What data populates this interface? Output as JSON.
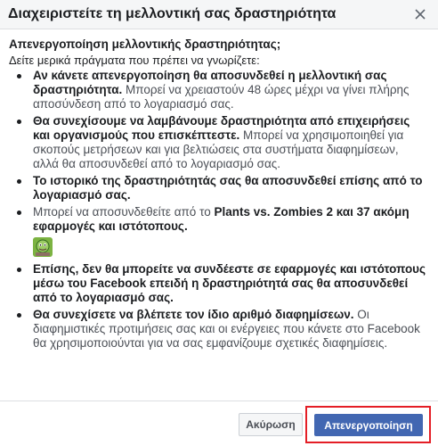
{
  "dialog": {
    "title": "Διαχειριστείτε τη μελλοντική σας δραστηριότητα",
    "close_icon": "close-icon"
  },
  "intro": {
    "question": "Απενεργοποίηση μελλοντικής δραστηριότητας;",
    "subtitle": "Δείτε μερικά πράγματα που πρέπει να γνωρίζετε:"
  },
  "points": [
    {
      "bold": "Αν κάνετε απενεργοποίηση θα αποσυνδεθεί η μελλοντική σας δραστηριότητα.",
      "rest": " Μπορεί να χρειαστούν 48 ώρες μέχρι να γίνει πλήρης αποσύνδεση από το λογαριασμό σας."
    },
    {
      "bold": "Θα συνεχίσουμε να λαμβάνουμε δραστηριότητα από επιχειρήσεις και οργανισμούς που επισκέπτεστε.",
      "rest": " Μπορεί να χρησιμοποιηθεί για σκοπούς μετρήσεων και για βελτιώσεις στα συστήματα διαφημίσεων, αλλά θα αποσυνδεθεί από το λογαριασμό σας."
    },
    {
      "bold": "Το ιστορικό της δραστηριότητάς σας θα αποσυνδεθεί επίσης από το λογαριασμό σας.",
      "rest": ""
    },
    {
      "prefix": "Μπορεί να αποσυνδεθείτε από το ",
      "bold": "Plants vs. Zombies 2 και 37 ακόμη εφαρμογές και ιστότοπους.",
      "icon": "plants-vs-zombies-app-icon"
    },
    {
      "bold": "Επίσης, δεν θα μπορείτε να συνδέεστε σε εφαρμογές και ιστότοπους μέσω του Facebook επειδή η δραστηριότητά σας θα αποσυνδεθεί από το λογαριασμό σας.",
      "rest": ""
    },
    {
      "bold": "Θα συνεχίσετε να βλέπετε τον ίδιο αριθμό διαφημίσεων.",
      "rest": " Οι διαφημιστικές προτιμήσεις σας και οι ενέργειες που κάνετε στο Facebook θα χρησιμοποιούνται για να σας εμφανίζουμε σχετικές διαφημίσεις."
    }
  ],
  "footer": {
    "cancel_label": "Ακύρωση",
    "confirm_label": "Απενεργοποίηση"
  },
  "colors": {
    "primary_button": "#4267b2",
    "highlight_border": "#e41e26",
    "header_bg": "#f5f6f7"
  }
}
